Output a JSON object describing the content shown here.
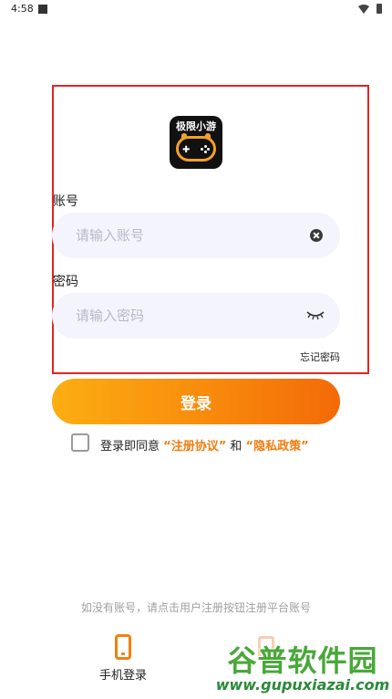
{
  "status_bar": {
    "time": "4:58"
  },
  "logo": {
    "text": "极限小游"
  },
  "account": {
    "label": "账号",
    "placeholder": "请输入账号",
    "value": ""
  },
  "password": {
    "label": "密码",
    "placeholder": "请输入密码",
    "value": ""
  },
  "forgot_password": "忘记密码",
  "login_button": "登录",
  "agreement": {
    "checked": false,
    "prefix": "登录即同意",
    "terms_link": "“注册协议”",
    "conjunction": "和",
    "privacy_link": "“隐私政策”"
  },
  "register_hint": "如没有账号，请点击用户注册按钮注册平台账号",
  "bottom": {
    "phone_login_label": "手机登录"
  },
  "watermark": {
    "title": "谷普软件园",
    "url": "www.gupuxiazai.com"
  },
  "colors": {
    "accent_start": "#fcae12",
    "accent_end": "#f36a08",
    "link": "#f07d10",
    "highlight_frame": "#e02525"
  }
}
